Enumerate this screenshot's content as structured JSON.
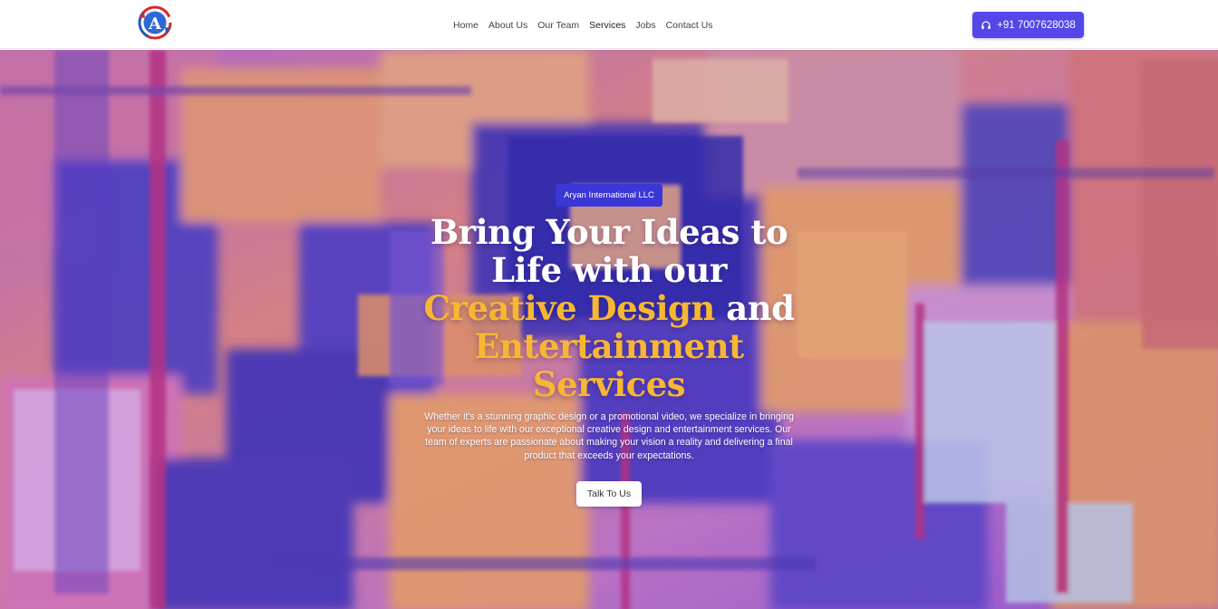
{
  "nav": {
    "logo_letter": "A",
    "items": [
      {
        "label": "Home"
      },
      {
        "label": "About Us"
      },
      {
        "label": "Our Team"
      },
      {
        "label": "Services"
      },
      {
        "label": "Jobs"
      },
      {
        "label": "Contact Us"
      }
    ],
    "phone": "+91 7007628038",
    "phone_icon": "headset-icon"
  },
  "hero": {
    "badge": "Aryan International LLC",
    "headline_line1": "Bring Your Ideas to",
    "headline_line2": "Life with our",
    "headline_highlight1": "Creative Design",
    "headline_and": "and",
    "headline_highlight2": "Entertainment",
    "headline_highlight3": "Services",
    "description": "Whether it's a stunning graphic design or a promotional video, we specialize in bringing your ideas to life with our exceptional creative design and entertainment services. Our team of experts are passionate about making your vision a reality and delivering a final product that exceeds your expectations.",
    "cta_label": "Talk To Us"
  },
  "colors": {
    "accent": "#5447e8",
    "badge": "#3b36d6",
    "highlight": "#f7b733"
  }
}
